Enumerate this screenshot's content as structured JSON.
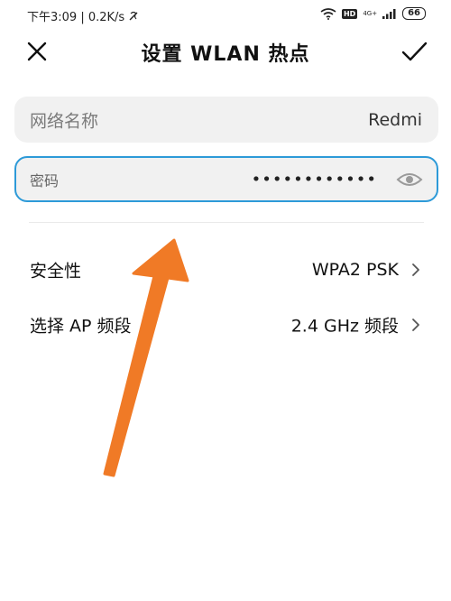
{
  "status_bar": {
    "time_speed": "下午3:09 | 0.2K/s",
    "hd": "HD",
    "net_top": "4G+",
    "net_bottom": "",
    "battery": "66"
  },
  "header": {
    "title": "设置 WLAN 热点",
    "close_icon": "close-icon",
    "confirm_icon": "check-icon"
  },
  "form": {
    "ssid_label": "网络名称",
    "ssid_value": "Redmi",
    "password_label": "密码",
    "password_mask": "••••••••••••",
    "eye_icon": "eye-icon"
  },
  "settings": {
    "security_label": "安全性",
    "security_value": "WPA2 PSK",
    "band_label": "选择 AP 频段",
    "band_value": "2.4 GHz 频段"
  },
  "colors": {
    "focus_border": "#2d9ad8",
    "annotation_arrow": "#f07a26",
    "field_bg": "#f1f1f1"
  }
}
